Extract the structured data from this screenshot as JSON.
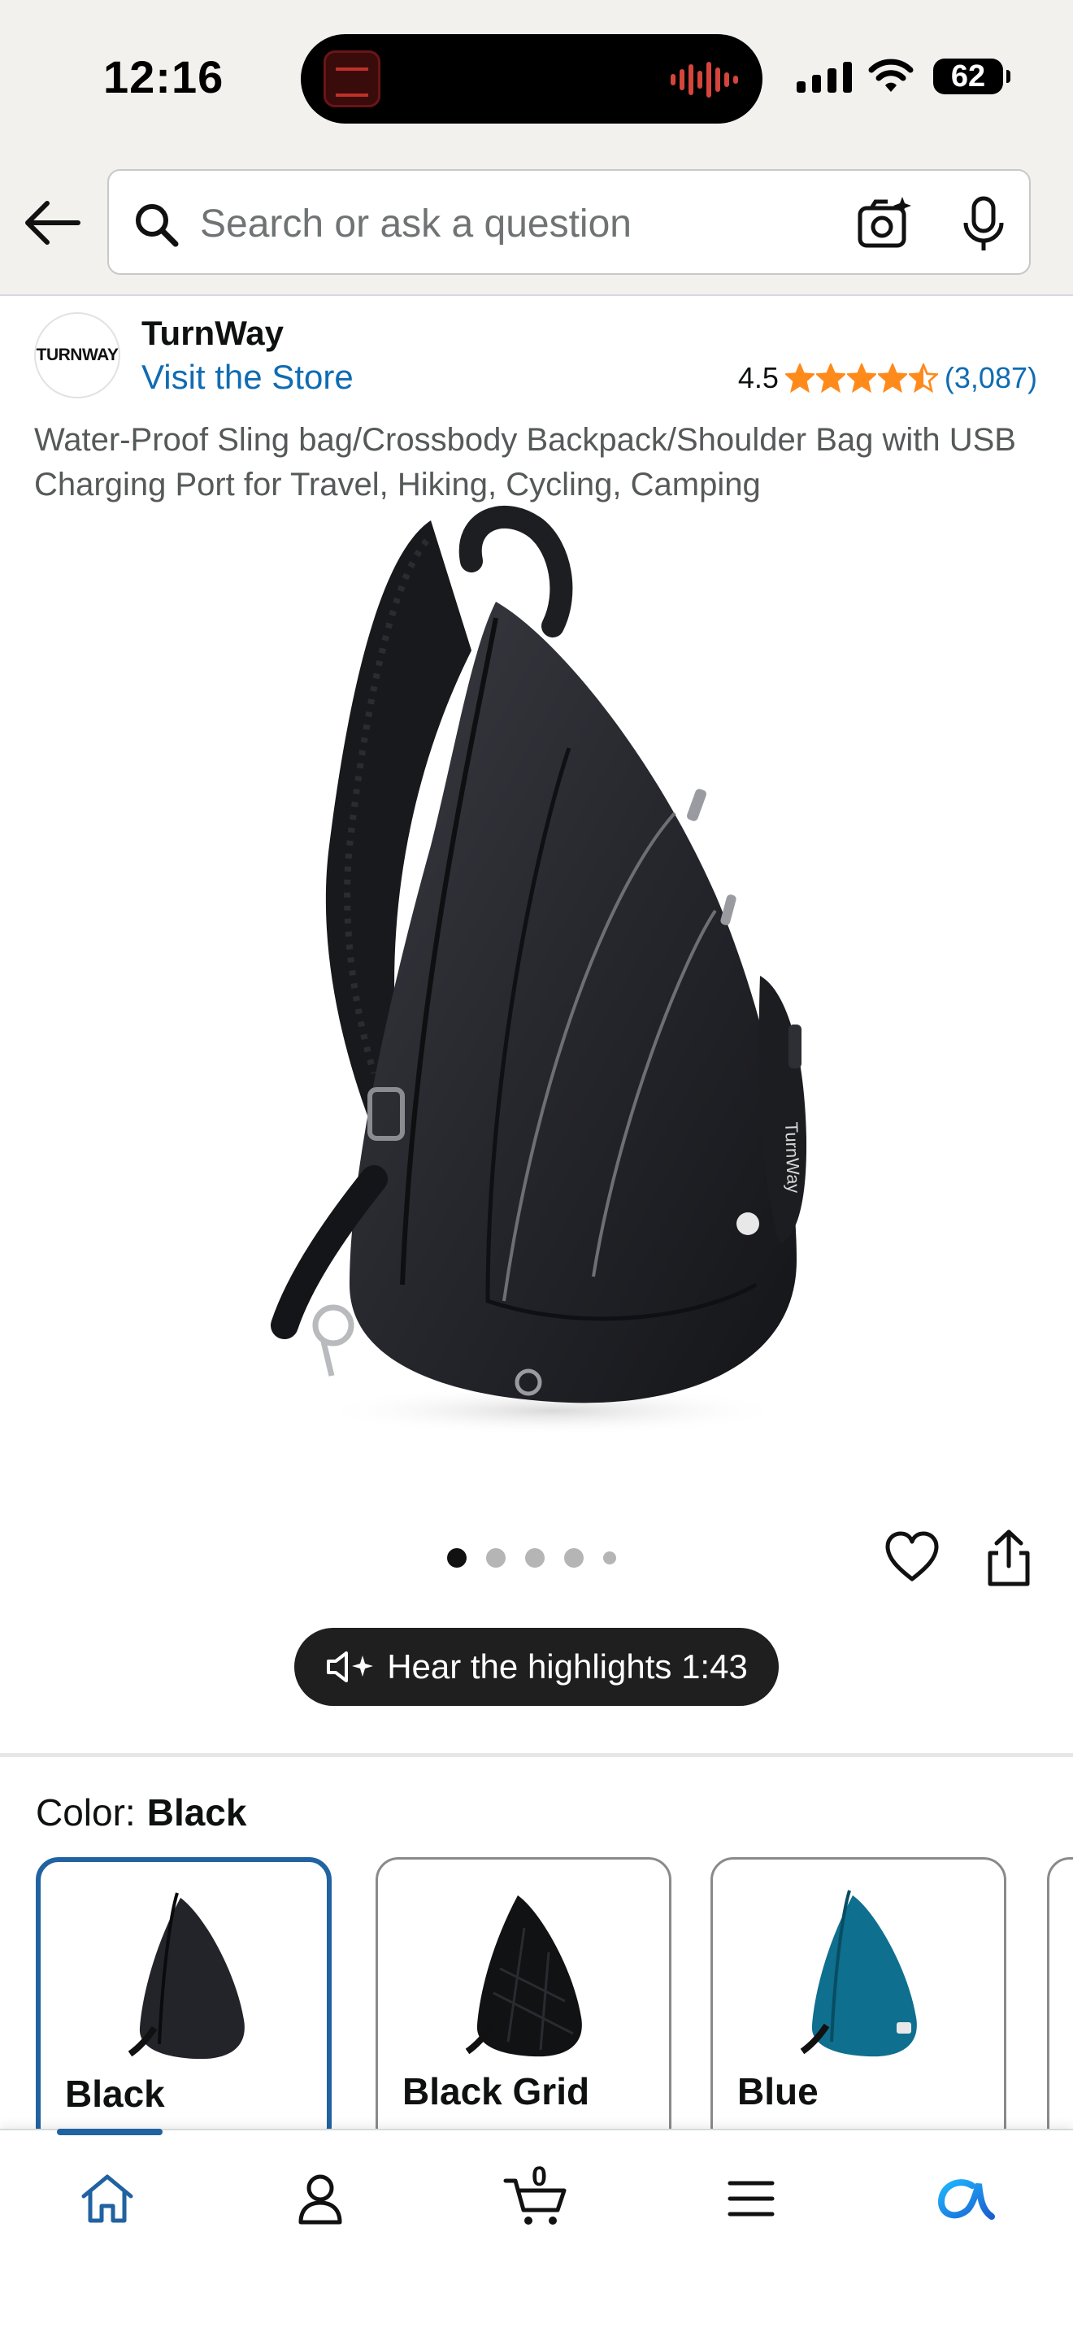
{
  "status_bar": {
    "time": "12:16",
    "battery": "62"
  },
  "search": {
    "placeholder": "Search or ask a question",
    "value": ""
  },
  "store": {
    "logo_text": "TURNWAY",
    "name": "TurnWay",
    "visit_label": "Visit the Store",
    "rating": "4.5",
    "rating_value": 4.5,
    "rating_count": "(3,087)"
  },
  "product": {
    "title": "Water-Proof Sling bag/Crossbody Backpack/Shoulder Bag with USB Charging Port for Travel, Hiking, Cycling, Camping",
    "image_count": 5,
    "current_image": 1
  },
  "audio": {
    "label": "Hear the highlights 1:43"
  },
  "color": {
    "label": "Color:",
    "selected": "Black",
    "options": [
      {
        "name": "Black",
        "color": "#23242a"
      },
      {
        "name": "Black Grid",
        "color": "#111214"
      },
      {
        "name": "Blue",
        "color": "#0e6f8e"
      }
    ]
  },
  "nav": {
    "cart_count": "0",
    "items": [
      "home-icon",
      "account-icon",
      "cart-icon",
      "menu-icon",
      "rufus-assistant-icon"
    ]
  },
  "colors": {
    "link": "#0f6cb3",
    "star": "#ff8a1c",
    "selected_border": "#2162a1",
    "nav_active": "#2162a1"
  }
}
